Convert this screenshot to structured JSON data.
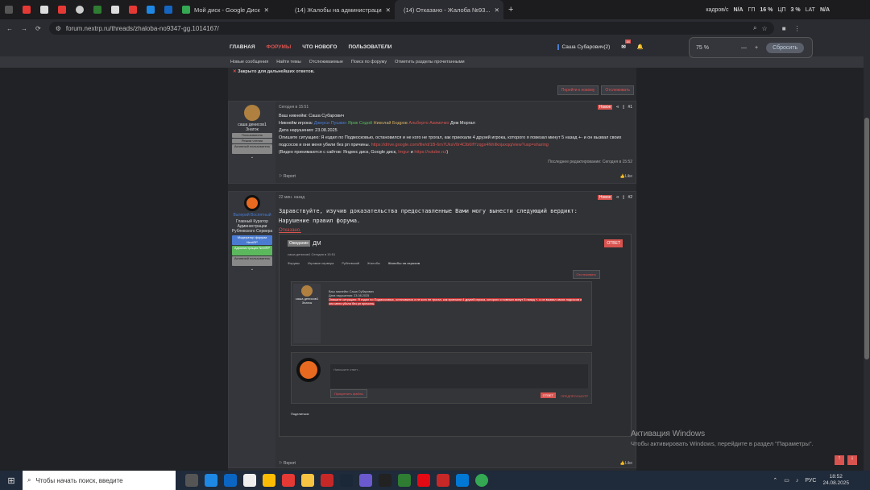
{
  "tabs": [
    {
      "label": ""
    },
    {
      "label": ""
    },
    {
      "label": ""
    },
    {
      "label": ""
    },
    {
      "label": ""
    },
    {
      "label": ""
    },
    {
      "label": ""
    },
    {
      "label": ""
    },
    {
      "label": "Мой диск - Google Диск"
    },
    {
      "label": "(14) Жалобы на администраци"
    },
    {
      "label": "(14) Отказано - Жалоба №93..."
    }
  ],
  "sys": {
    "net": "кадров/с",
    "na1": "N/A",
    "gpu": "ГП",
    "gpu_v": "16 %",
    "cpu": "ЦП",
    "cpu_v": "3 %",
    "lat": "LAT",
    "na2": "N/A"
  },
  "url": "forum.nextrp.ru/threads/zhaloba-no9347-gg.1014167/",
  "nav": {
    "home": "ГЛАВНАЯ",
    "forums": "ФОРУМЫ",
    "new": "ЧТО НОВОГО",
    "users": "ПОЛЬЗОВАТЕЛИ",
    "user": "Саша Субарович(2)",
    "badge": "14"
  },
  "subnav": [
    "Новые сообщения",
    "Найти темы",
    "Отслеживаемые",
    "Поиск по форуму",
    "Отметить разделы прочитанными"
  ],
  "zoom": {
    "value": "75 %",
    "reset": "Сбросить"
  },
  "closed": "Закрыто для дальнейших ответов.",
  "actions": {
    "goto": "Перейти к новому",
    "watch": "Отслеживать"
  },
  "post1": {
    "user": "саша денисов1",
    "role": "Знаток",
    "b1": "Пользователь",
    "b2": "Режим чтения",
    "b3": "Активный пользователь",
    "time": "Сегодня в 15:51",
    "tag": "Новое",
    "num": "#1",
    "l1": "Ваш никнейм: Саша Субарович",
    "l2a": "Никнейм игрока: ",
    "l2b": "Джерси Пушкин",
    "l2c": "Ярик Седой",
    "l2d": "Николай Бодров",
    "l2e": "Альберто Акимочко",
    "l2f": "Деж Моргал",
    "l3": "Дата нарушения: 23.08.2025",
    "l4": "Опишите ситуацию: Я ездил по Подмосковью, остановился и не кого не трогал, как приехали 4 друзей игрока, которого я повезал минут 5 назад +- и он вызвал своих подсосов и они меня убили без рп причины.",
    "link": "https://drive.google.com/file/d/1B-6m7UksV0r4Clb6lfYzqgx4NhIlknjaxqq/view?usp=sharing",
    "l5": "(Видео принимаются с сайтов: Яндекс диск, Google диск, ",
    "l5a": "Imgur",
    "l5b": " и ",
    "l5c": "https://rutube.ru/",
    "l5d": ")",
    "edited": "Последнее редактирование: Сегодня в 15:52",
    "report": "Report",
    "like": "Like"
  },
  "post2": {
    "user": "Валерий Воспятный",
    "role": "Главный Куратор Администрации Рублевского Сервера",
    "b1": "Модератор форума NextRP",
    "b2": "Администрация NextRP",
    "b3": "Активный пользователь",
    "time": "22 мин. назад",
    "tag": "Новое",
    "num": "#2",
    "l1": "Здравствуйте, изучив доказательства предоставленные Вами могу вынести следующий вердикт:",
    "l2": "Нарушение правил форума.",
    "l3": "Отказано.",
    "report": "Report",
    "like": "Like"
  },
  "shot": {
    "status": "Ожидание",
    "title": "ДМ",
    "meta": "саша денисов1  Сегодня в 15:51",
    "reply": "ОТВЕТ",
    "crumbs": [
      "Форумы",
      "Игровые сервера",
      "Рублевский",
      "Жалобы",
      "Жалобы на игроков"
    ],
    "watch": "Отслеживать",
    "user": "саша денисов1",
    "role": "Знаток",
    "editor": "Напишите ответ...",
    "attach": "Прикрепить файлы",
    "send": "ОТВЕТ",
    "preview": "ПРЕДПРОСМОТР",
    "share": "Поделиться:"
  },
  "watermark": {
    "t1": "Активация Windows",
    "t2": "Чтобы активировать Windows, перейдите в раздел \"Параметры\"."
  },
  "taskbar": {
    "search": "Чтобы начать поиск, введите",
    "lang": "РУС",
    "time": "18:52",
    "date": "24.08.2025"
  },
  "colors": {
    "accent": "#d9534f",
    "green": "#5cb85c",
    "blue": "#4a7bd0"
  }
}
